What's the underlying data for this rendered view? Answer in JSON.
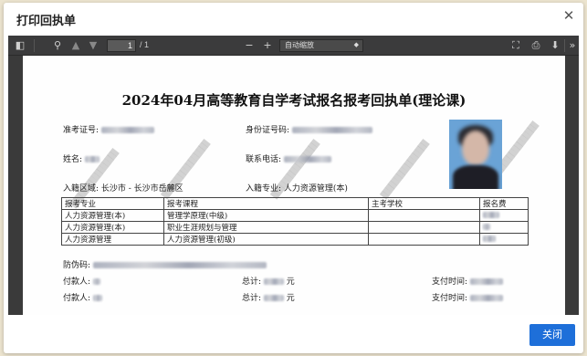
{
  "modal": {
    "title": "打印回执单",
    "close_label": "关闭"
  },
  "toolbar": {
    "page_current": "1",
    "page_total": "/ 1",
    "zoom_value": "自动缩放",
    "icons": [
      "sidebar-toggle-icon",
      "search-icon",
      "previous-page-icon",
      "next-page-icon",
      "zoom-out-icon",
      "zoom-in-icon",
      "presentation-mode-icon",
      "print-icon",
      "download-icon",
      "more-tools-icon"
    ]
  },
  "document": {
    "title": "2024年04月高等教育自学考试报名报考回执单(理论课)",
    "labels": {
      "admission_no": "准考证号:",
      "id_no": "身份证号码:",
      "name": "姓名:",
      "phone": "联系电话:",
      "region": "入籍区域: 长沙市 - 长沙市岳麓区",
      "major": "入籍专业: 人力资源管理(本)",
      "anti_fake": "防伪码:",
      "payer1": "付款人:",
      "payer2": "付款人:",
      "total1": "总计:",
      "total2": "总计:",
      "yuan1": "元",
      "yuan2": "元",
      "paytime1": "支付时间:",
      "paytime2": "支付时间:"
    },
    "table": {
      "headers": [
        "报考专业",
        "报考课程",
        "主考学校",
        "报名费"
      ],
      "rows": [
        [
          "人力资源管理(本)",
          "管理学原理(中级)",
          "",
          ""
        ],
        [
          "人力资源管理(本)",
          "职业生涯规划与管理",
          "",
          ""
        ],
        [
          "人力资源管理",
          "人力资源管理(初级)",
          "",
          ""
        ]
      ]
    }
  },
  "colors": {
    "primary_button": "#1e6fd9",
    "viewer_bg": "#3a3a3a",
    "page_bg": "#ece4cf"
  }
}
